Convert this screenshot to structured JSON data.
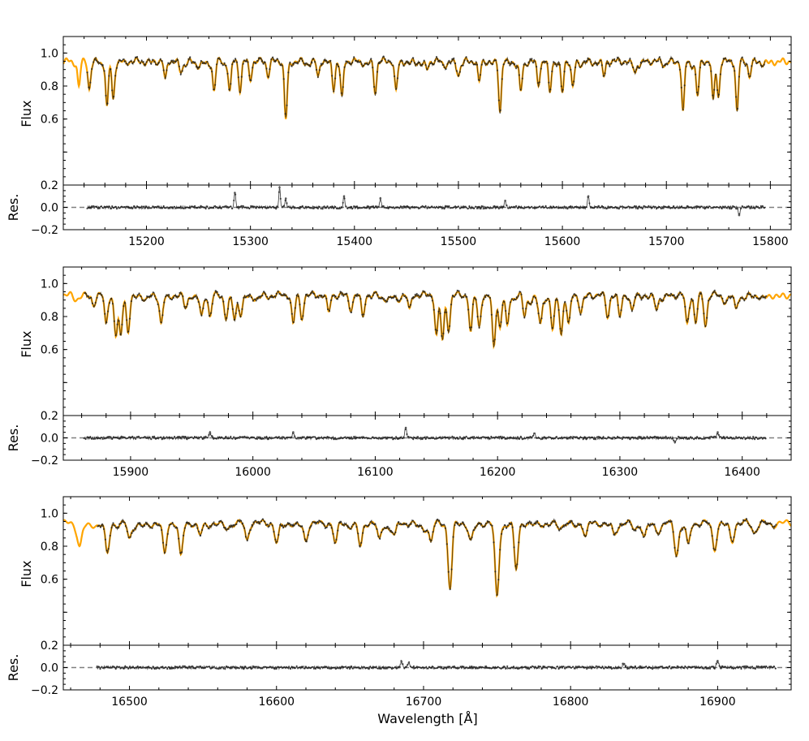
{
  "figure": {
    "xlabel": "Wavelength [Å]",
    "colors": {
      "model": "#FFA500",
      "observed": "#1a1a1a",
      "zero_line": "#808080",
      "axes": "#000000"
    }
  },
  "chart_data": [
    {
      "type": "line",
      "panel": "top",
      "ylabel": "Flux",
      "res_ylabel": "Res.",
      "xlim": [
        15120,
        15820
      ],
      "ylim": [
        0.2,
        1.1
      ],
      "res_ylim": [
        -0.2,
        0.2
      ],
      "xticks": [
        "15200",
        "15300",
        "15400",
        "15500",
        "15600",
        "15700",
        "15800"
      ],
      "yticks": [
        "0.2",
        "0.4",
        "0.6",
        "0.8",
        "1.0"
      ],
      "yticks_visible": [
        "0.6",
        "0.8",
        "1.0"
      ],
      "res_yticks": [
        "−0.2",
        "0.0",
        "0.2"
      ],
      "model_range": [
        15120,
        15820
      ],
      "obs_range": [
        15143,
        15795
      ],
      "continuum": 0.95,
      "lines": [
        [
          15135,
          0.8
        ],
        [
          15145,
          0.78
        ],
        [
          15162,
          0.68
        ],
        [
          15168,
          0.72
        ],
        [
          15218,
          0.85
        ],
        [
          15233,
          0.88
        ],
        [
          15265,
          0.77
        ],
        [
          15280,
          0.77
        ],
        [
          15290,
          0.76
        ],
        [
          15300,
          0.83
        ],
        [
          15317,
          0.85
        ],
        [
          15334,
          0.6
        ],
        [
          15365,
          0.86
        ],
        [
          15380,
          0.77
        ],
        [
          15388,
          0.74
        ],
        [
          15420,
          0.75
        ],
        [
          15440,
          0.78
        ],
        [
          15470,
          0.9
        ],
        [
          15500,
          0.86
        ],
        [
          15520,
          0.83
        ],
        [
          15540,
          0.64
        ],
        [
          15560,
          0.77
        ],
        [
          15577,
          0.8
        ],
        [
          15588,
          0.76
        ],
        [
          15600,
          0.76
        ],
        [
          15610,
          0.8
        ],
        [
          15640,
          0.86
        ],
        [
          15670,
          0.88
        ],
        [
          15716,
          0.65
        ],
        [
          15730,
          0.74
        ],
        [
          15745,
          0.72
        ],
        [
          15750,
          0.73
        ],
        [
          15768,
          0.65
        ],
        [
          15780,
          0.85
        ]
      ],
      "res_spikes": [
        [
          15285,
          0.13
        ],
        [
          15328,
          0.18
        ],
        [
          15334,
          0.08
        ],
        [
          15390,
          0.1
        ],
        [
          15425,
          0.08
        ],
        [
          15545,
          0.06
        ],
        [
          15625,
          0.1
        ],
        [
          15770,
          -0.07
        ]
      ]
    },
    {
      "type": "line",
      "panel": "middle",
      "ylabel": "Flux",
      "res_ylabel": "Res.",
      "xlim": [
        15845,
        16440
      ],
      "ylim": [
        0.2,
        1.1
      ],
      "res_ylim": [
        -0.2,
        0.2
      ],
      "xticks": [
        "15900",
        "16000",
        "16100",
        "16200",
        "16300",
        "16400"
      ],
      "yticks": [
        "0.2",
        "0.4",
        "0.6",
        "0.8",
        "1.0"
      ],
      "yticks_visible": [
        "0.6",
        "0.8",
        "1.0"
      ],
      "res_yticks": [
        "−0.2",
        "0.0",
        "0.2"
      ],
      "model_range": [
        15845,
        16440
      ],
      "obs_range": [
        15862,
        16420
      ],
      "continuum": 0.93,
      "lines": [
        [
          15870,
          0.86
        ],
        [
          15880,
          0.76
        ],
        [
          15888,
          0.68
        ],
        [
          15892,
          0.69
        ],
        [
          15898,
          0.7
        ],
        [
          15925,
          0.76
        ],
        [
          15945,
          0.85
        ],
        [
          15958,
          0.81
        ],
        [
          15965,
          0.8
        ],
        [
          15978,
          0.78
        ],
        [
          15985,
          0.78
        ],
        [
          15990,
          0.8
        ],
        [
          16033,
          0.76
        ],
        [
          16040,
          0.78
        ],
        [
          16062,
          0.83
        ],
        [
          16080,
          0.83
        ],
        [
          16090,
          0.8
        ],
        [
          16128,
          0.85
        ],
        [
          16150,
          0.69
        ],
        [
          16155,
          0.66
        ],
        [
          16160,
          0.71
        ],
        [
          16178,
          0.71
        ],
        [
          16185,
          0.74
        ],
        [
          16197,
          0.62
        ],
        [
          16202,
          0.73
        ],
        [
          16208,
          0.75
        ],
        [
          16222,
          0.8
        ],
        [
          16235,
          0.76
        ],
        [
          16245,
          0.72
        ],
        [
          16252,
          0.69
        ],
        [
          16258,
          0.76
        ],
        [
          16268,
          0.82
        ],
        [
          16290,
          0.79
        ],
        [
          16300,
          0.8
        ],
        [
          16310,
          0.84
        ],
        [
          16330,
          0.84
        ],
        [
          16355,
          0.76
        ],
        [
          16362,
          0.76
        ],
        [
          16370,
          0.74
        ],
        [
          16395,
          0.85
        ]
      ],
      "res_spikes": [
        [
          15965,
          0.05
        ],
        [
          16033,
          0.05
        ],
        [
          16125,
          0.09
        ],
        [
          16230,
          0.04
        ],
        [
          16345,
          -0.04
        ],
        [
          16380,
          0.05
        ]
      ]
    },
    {
      "type": "line",
      "panel": "bottom",
      "ylabel": "Flux",
      "res_ylabel": "Res.",
      "xlim": [
        16455,
        16950
      ],
      "ylim": [
        0.2,
        1.1
      ],
      "res_ylim": [
        -0.2,
        0.2
      ],
      "xticks": [
        "16500",
        "16600",
        "16700",
        "16800",
        "16900"
      ],
      "yticks": [
        "0.2",
        "0.4",
        "0.6",
        "0.8",
        "1.0"
      ],
      "yticks_visible": [
        "0.6",
        "0.8",
        "1.0"
      ],
      "res_yticks": [
        "−0.2",
        "0.0",
        "0.2"
      ],
      "model_range": [
        16455,
        16950
      ],
      "obs_range": [
        16478,
        16940
      ],
      "continuum": 0.94,
      "lines": [
        [
          16466,
          0.8
        ],
        [
          16485,
          0.76
        ],
        [
          16500,
          0.85
        ],
        [
          16524,
          0.76
        ],
        [
          16535,
          0.75
        ],
        [
          16548,
          0.87
        ],
        [
          16580,
          0.84
        ],
        [
          16600,
          0.82
        ],
        [
          16620,
          0.83
        ],
        [
          16640,
          0.82
        ],
        [
          16657,
          0.8
        ],
        [
          16670,
          0.85
        ],
        [
          16680,
          0.87
        ],
        [
          16705,
          0.83
        ],
        [
          16718,
          0.54
        ],
        [
          16732,
          0.84
        ],
        [
          16750,
          0.5
        ],
        [
          16763,
          0.66
        ],
        [
          16810,
          0.86
        ],
        [
          16830,
          0.87
        ],
        [
          16850,
          0.86
        ],
        [
          16872,
          0.74
        ],
        [
          16880,
          0.82
        ],
        [
          16898,
          0.77
        ],
        [
          16910,
          0.82
        ],
        [
          16925,
          0.88
        ]
      ],
      "res_spikes": [
        [
          16685,
          0.05
        ],
        [
          16690,
          0.04
        ],
        [
          16836,
          0.03
        ],
        [
          16900,
          0.06
        ]
      ]
    }
  ]
}
